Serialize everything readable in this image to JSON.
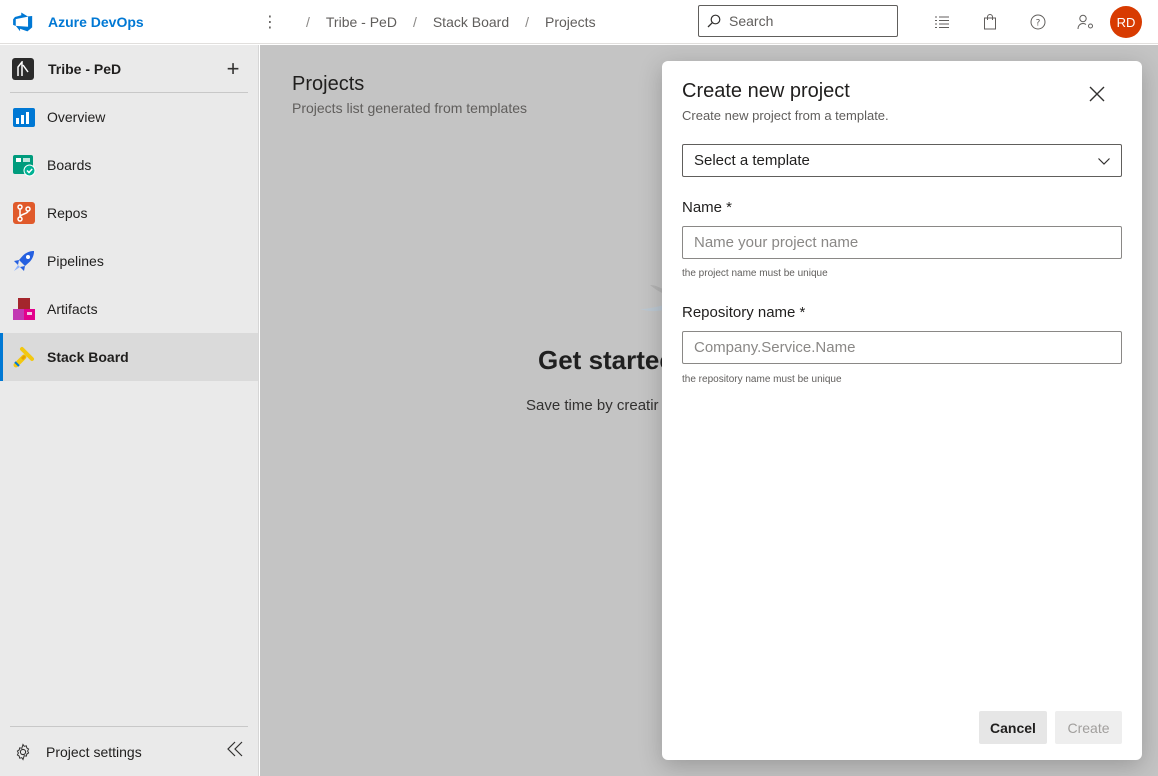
{
  "app": {
    "name": "Azure DevOps"
  },
  "breadcrumbs": [
    "Tribe - PeD",
    "Stack Board",
    "Projects"
  ],
  "search": {
    "placeholder": "Search"
  },
  "user": {
    "initials": "RD",
    "avatar_color": "#d83b01"
  },
  "colors": {
    "accent": "#0078d4",
    "overlay": "#c4c4c4"
  },
  "sidebar": {
    "project_name": "Tribe - PeD",
    "add_label": "+",
    "items": [
      {
        "label": "Overview",
        "icon": "overview-icon"
      },
      {
        "label": "Boards",
        "icon": "boards-icon"
      },
      {
        "label": "Repos",
        "icon": "repos-icon"
      },
      {
        "label": "Pipelines",
        "icon": "pipelines-icon"
      },
      {
        "label": "Artifacts",
        "icon": "artifacts-icon"
      },
      {
        "label": "Stack Board",
        "icon": "stack-board-icon",
        "active": true
      }
    ],
    "settings_label": "Project settings"
  },
  "main": {
    "title": "Projects",
    "subtitle": "Projects list generated from templates",
    "empty_title": "Get startec",
    "empty_text": "Save time by creatir"
  },
  "dialog": {
    "title": "Create new project",
    "subtitle": "Create new project from a template.",
    "template_select": {
      "value": "Select a template"
    },
    "name_field": {
      "label": "Name *",
      "placeholder": "Name your project name",
      "hint": "the project name must be unique"
    },
    "repo_field": {
      "label": "Repository name *",
      "placeholder": "Company.Service.Name",
      "hint": "the repository name must be unique"
    },
    "cancel_label": "Cancel",
    "create_label": "Create"
  }
}
